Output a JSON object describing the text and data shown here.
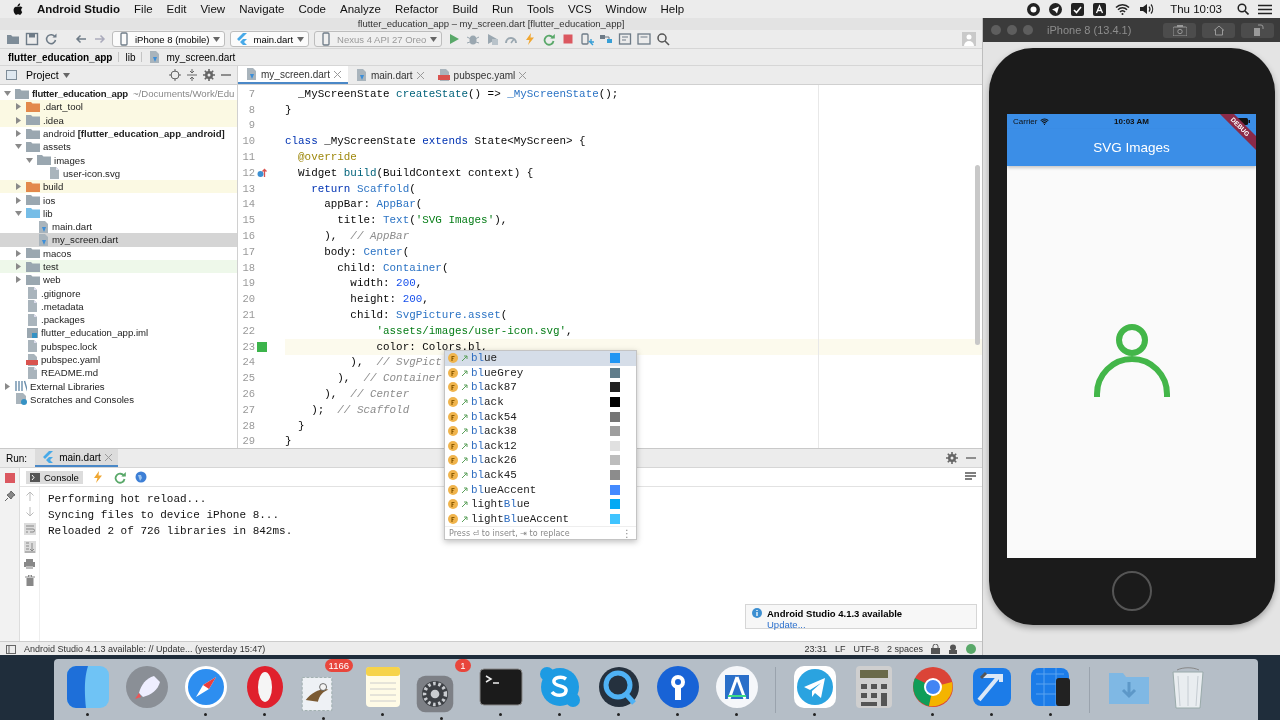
{
  "menu_bar": {
    "app": "Android Studio",
    "items": [
      "File",
      "Edit",
      "View",
      "Navigate",
      "Code",
      "Analyze",
      "Refactor",
      "Build",
      "Run",
      "Tools",
      "VCS",
      "Window",
      "Help"
    ],
    "clock": "Thu 10:03"
  },
  "ide": {
    "title": "flutter_education_app – my_screen.dart [flutter_education_app]",
    "toolbar": {
      "device": "iPhone 8 (mobile)",
      "config": "main.dart",
      "emulator": {
        "label": "Nexus 4 API 27 Oreo",
        "disabled": true
      }
    },
    "breadcrumb": [
      "flutter_education_app",
      "lib",
      "my_screen.dart"
    ],
    "project_panel": {
      "title": "Project",
      "tree": [
        {
          "label": "flutter_education_app",
          "path": "~/Documents/Work/Edu",
          "kind": "folder",
          "expanded": true,
          "selected": false,
          "children": [
            {
              "label": ".dart_tool",
              "kind": "excluded_folder",
              "expanded": false,
              "selected": false,
              "ignored": true
            },
            {
              "label": ".idea",
              "kind": "folder",
              "expanded": false,
              "selected": false,
              "ignored": true
            },
            {
              "label": "android **[flutter_education_app_android]**",
              "kind": "folder",
              "expanded": false,
              "selected": false
            },
            {
              "label": "assets",
              "kind": "folder",
              "expanded": true,
              "selected": false,
              "children": [
                {
                  "label": "images",
                  "kind": "folder",
                  "expanded": true,
                  "selected": false,
                  "children": [
                    {
                      "label": "user-icon.svg",
                      "kind": "file",
                      "selected": false
                    }
                  ]
                }
              ]
            },
            {
              "label": "build",
              "kind": "excluded_folder",
              "expanded": false,
              "selected": false,
              "ignored": true
            },
            {
              "label": "ios",
              "kind": "folder",
              "expanded": false,
              "selected": false
            },
            {
              "label": "lib",
              "kind": "source_folder",
              "expanded": true,
              "selected": false,
              "children": [
                {
                  "label": "main.dart",
                  "kind": "dart_file",
                  "selected": false
                },
                {
                  "label": "my_screen.dart",
                  "kind": "dart_file",
                  "selected": true
                }
              ]
            },
            {
              "label": "macos",
              "kind": "folder",
              "expanded": false,
              "selected": false
            },
            {
              "label": "test",
              "kind": "folder",
              "expanded": false,
              "selected": false,
              "test_root": true
            },
            {
              "label": "web",
              "kind": "folder",
              "expanded": false,
              "selected": false
            },
            {
              "label": ".gitignore",
              "kind": "file",
              "selected": false
            },
            {
              "label": ".metadata",
              "kind": "file",
              "selected": false
            },
            {
              "label": ".packages",
              "kind": "file",
              "selected": false
            },
            {
              "label": "flutter_education_app.iml",
              "kind": "module_file",
              "selected": false
            },
            {
              "label": "pubspec.lock",
              "kind": "file",
              "selected": false
            },
            {
              "label": "pubspec.yaml",
              "kind": "yaml_file",
              "selected": false
            },
            {
              "label": "README.md",
              "kind": "file",
              "selected": false
            }
          ]
        },
        {
          "label": "External Libraries",
          "kind": "library",
          "expanded": false,
          "selected": false
        },
        {
          "label": "Scratches and Consoles",
          "kind": "scratches",
          "selected": false
        }
      ]
    },
    "editor_tabs": [
      {
        "label": "my_screen.dart",
        "kind": "dart",
        "selected": true
      },
      {
        "label": "main.dart",
        "kind": "dart",
        "selected": false
      },
      {
        "label": "pubspec.yaml",
        "kind": "yaml",
        "selected": false
      }
    ],
    "code_lines": [
      {
        "number": "7",
        "tokens": [
          {
            "kind": "plain",
            "text": "  _MyScreenState "
          },
          {
            "kind": "fn",
            "text": "createState"
          },
          {
            "kind": "plain",
            "text": "() => "
          },
          {
            "kind": "type",
            "text": "_MyScreenState"
          },
          {
            "kind": "plain",
            "text": "();"
          }
        ]
      },
      {
        "number": "8",
        "tokens": [
          {
            "kind": "plain",
            "text": "}"
          }
        ]
      },
      {
        "number": "9"
      },
      {
        "number": "10",
        "tokens": [
          {
            "kind": "keyword",
            "text": "class"
          },
          {
            "kind": "plain",
            "text": " _MyScreenState "
          },
          {
            "kind": "keyword",
            "text": "extends"
          },
          {
            "kind": "plain",
            "text": " State<MyScreen> {"
          }
        ]
      },
      {
        "number": "11",
        "tokens": [
          {
            "kind": "annotation",
            "text": "  @override"
          }
        ]
      },
      {
        "number": "12",
        "override": true,
        "tokens": [
          {
            "kind": "plain",
            "text": "  Widget "
          },
          {
            "kind": "fn",
            "text": "build"
          },
          {
            "kind": "plain",
            "text": "(BuildContext context) {"
          }
        ]
      },
      {
        "number": "13",
        "tokens": [
          {
            "kind": "keyword",
            "text": "    return "
          },
          {
            "kind": "type",
            "text": "Scaffold"
          },
          {
            "kind": "plain",
            "text": "("
          }
        ]
      },
      {
        "number": "14",
        "tokens": [
          {
            "kind": "plain",
            "text": "      appBar: "
          },
          {
            "kind": "type",
            "text": "AppBar"
          },
          {
            "kind": "plain",
            "text": "("
          }
        ]
      },
      {
        "number": "15",
        "tokens": [
          {
            "kind": "plain",
            "text": "        title: "
          },
          {
            "kind": "type",
            "text": "Text"
          },
          {
            "kind": "plain",
            "text": "("
          },
          {
            "kind": "string",
            "text": "'SVG Images'"
          },
          {
            "kind": "plain",
            "text": "),"
          }
        ]
      },
      {
        "number": "16",
        "tokens": [
          {
            "kind": "plain",
            "text": "      ),  "
          },
          {
            "kind": "comment",
            "text": "// AppBar"
          }
        ]
      },
      {
        "number": "17",
        "tokens": [
          {
            "kind": "plain",
            "text": "      body: "
          },
          {
            "kind": "type",
            "text": "Center"
          },
          {
            "kind": "plain",
            "text": "("
          }
        ]
      },
      {
        "number": "18",
        "tokens": [
          {
            "kind": "plain",
            "text": "        child: "
          },
          {
            "kind": "type",
            "text": "Container"
          },
          {
            "kind": "plain",
            "text": "("
          }
        ]
      },
      {
        "number": "19",
        "tokens": [
          {
            "kind": "plain",
            "text": "          width: "
          },
          {
            "kind": "number",
            "text": "200"
          },
          {
            "kind": "plain",
            "text": ","
          }
        ]
      },
      {
        "number": "20",
        "tokens": [
          {
            "kind": "plain",
            "text": "          height: "
          },
          {
            "kind": "number",
            "text": "200"
          },
          {
            "kind": "plain",
            "text": ","
          }
        ]
      },
      {
        "number": "21",
        "tokens": [
          {
            "kind": "plain",
            "text": "          child: "
          },
          {
            "kind": "type",
            "text": "SvgPicture.asset"
          },
          {
            "kind": "plain",
            "text": "("
          }
        ]
      },
      {
        "number": "22",
        "tokens": [
          {
            "kind": "string",
            "text": "              'assets/images/user-icon.svg'"
          },
          {
            "kind": "plain",
            "text": ","
          }
        ]
      },
      {
        "number": "23",
        "current": true,
        "color": "#3cb44b",
        "tokens": [
          {
            "kind": "plain",
            "text": "              color: Colors.bl,"
          }
        ]
      },
      {
        "number": "24",
        "tokens": [
          {
            "kind": "plain",
            "text": "          ),  "
          },
          {
            "kind": "comment",
            "text": "// SvgPict"
          }
        ]
      },
      {
        "number": "25",
        "tokens": [
          {
            "kind": "plain",
            "text": "        ),  "
          },
          {
            "kind": "comment",
            "text": "// Container"
          }
        ]
      },
      {
        "number": "26",
        "tokens": [
          {
            "kind": "plain",
            "text": "      ),  "
          },
          {
            "kind": "comment",
            "text": "// Center"
          }
        ]
      },
      {
        "number": "27",
        "tokens": [
          {
            "kind": "plain",
            "text": "    );  "
          },
          {
            "kind": "comment",
            "text": "// Scaffold"
          }
        ]
      },
      {
        "number": "28",
        "tokens": [
          {
            "kind": "plain",
            "text": "  }"
          }
        ]
      },
      {
        "number": "29",
        "tokens": [
          {
            "kind": "plain",
            "text": "}"
          }
        ]
      }
    ],
    "completion": {
      "items": [
        {
          "parts": [
            {
              "text": "bl",
              "match": true
            },
            {
              "text": "ue",
              "match": false
            }
          ],
          "color": "#2196f3",
          "selected": true
        },
        {
          "parts": [
            {
              "text": "bl",
              "match": true
            },
            {
              "text": "ueGrey",
              "match": false
            }
          ],
          "color": "#607d8b",
          "selected": false
        },
        {
          "parts": [
            {
              "text": "bl",
              "match": true
            },
            {
              "text": "ack87",
              "match": false
            }
          ],
          "color": "#212121",
          "selected": false
        },
        {
          "parts": [
            {
              "text": "bl",
              "match": true
            },
            {
              "text": "ack",
              "match": false
            }
          ],
          "color": "#000000",
          "selected": false
        },
        {
          "parts": [
            {
              "text": "bl",
              "match": true
            },
            {
              "text": "ack54",
              "match": false
            }
          ],
          "color": "#757575",
          "selected": false
        },
        {
          "parts": [
            {
              "text": "bl",
              "match": true
            },
            {
              "text": "ack38",
              "match": false
            }
          ],
          "color": "#9e9e9e",
          "selected": false
        },
        {
          "parts": [
            {
              "text": "bl",
              "match": true
            },
            {
              "text": "ack12",
              "match": false
            }
          ],
          "color": "#e0e0e0",
          "selected": false
        },
        {
          "parts": [
            {
              "text": "bl",
              "match": true
            },
            {
              "text": "ack26",
              "match": false
            }
          ],
          "color": "#bdbdbd",
          "selected": false
        },
        {
          "parts": [
            {
              "text": "bl",
              "match": true
            },
            {
              "text": "ack45",
              "match": false
            }
          ],
          "color": "#8c8c8c",
          "selected": false
        },
        {
          "parts": [
            {
              "text": "bl",
              "match": true
            },
            {
              "text": "ueAccent",
              "match": false
            }
          ],
          "color": "#448aff",
          "selected": false
        },
        {
          "parts": [
            {
              "text": "light",
              "match": false
            },
            {
              "text": "Bl",
              "match": true
            },
            {
              "text": "ue",
              "match": false
            }
          ],
          "color": "#03a9f4",
          "selected": false
        },
        {
          "parts": [
            {
              "text": "light",
              "match": false
            },
            {
              "text": "Bl",
              "match": true
            },
            {
              "text": "ueAccent",
              "match": false
            }
          ],
          "color": "#40c4ff",
          "selected": false
        }
      ],
      "hint": "Press ⏎ to insert, ⇥ to replace",
      "menu": "⋮"
    },
    "run_panel": {
      "label": "Run:",
      "tab": {
        "label": "main.dart",
        "selected": true
      },
      "console_tab": {
        "label": "Console",
        "selected": true
      },
      "output": [
        "Performing hot reload...",
        "Syncing files to device iPhone 8...",
        "Reloaded 2 of 726 libraries in 842ms."
      ]
    },
    "notification": {
      "title": "Android Studio 4.1.3 available",
      "link": "Update..."
    },
    "status_bar": {
      "message": "Android Studio 4.1.3 available: // Update... (yesterday 15:47)",
      "items": [
        "23:31",
        "LF",
        "UTF-8",
        "2 spaces"
      ]
    }
  },
  "simulator": {
    "title": "iPhone 8 (13.4.1)",
    "carrier": "Carrier",
    "time": "10:03 AM",
    "banner": "DEBUG",
    "app_title": "SVG Images"
  },
  "dock": {
    "groups": [
      {
        "apps": [
          {
            "kind": "finder",
            "running": true
          },
          {
            "kind": "launchpad",
            "running": false
          },
          {
            "kind": "safari",
            "running": true
          },
          {
            "kind": "opera",
            "running": true
          },
          {
            "kind": "mail",
            "running": true,
            "badge": "1166"
          },
          {
            "kind": "notes",
            "running": true
          },
          {
            "kind": "settings",
            "running": true,
            "badge": "1"
          },
          {
            "kind": "terminal",
            "running": true
          },
          {
            "kind": "skype",
            "running": true
          },
          {
            "kind": "quicktime",
            "running": true
          },
          {
            "kind": "pin",
            "running": true
          },
          {
            "kind": "studio",
            "running": true
          }
        ]
      },
      {
        "apps": [
          {
            "kind": "telegram",
            "running": true
          },
          {
            "kind": "calculator",
            "running": false
          },
          {
            "kind": "chrome",
            "running": true
          },
          {
            "kind": "xcode",
            "running": true
          },
          {
            "kind": "simulator",
            "running": true
          }
        ]
      },
      {
        "apps": [
          {
            "kind": "folder",
            "running": false
          },
          {
            "kind": "trash",
            "running": false
          }
        ]
      }
    ]
  }
}
